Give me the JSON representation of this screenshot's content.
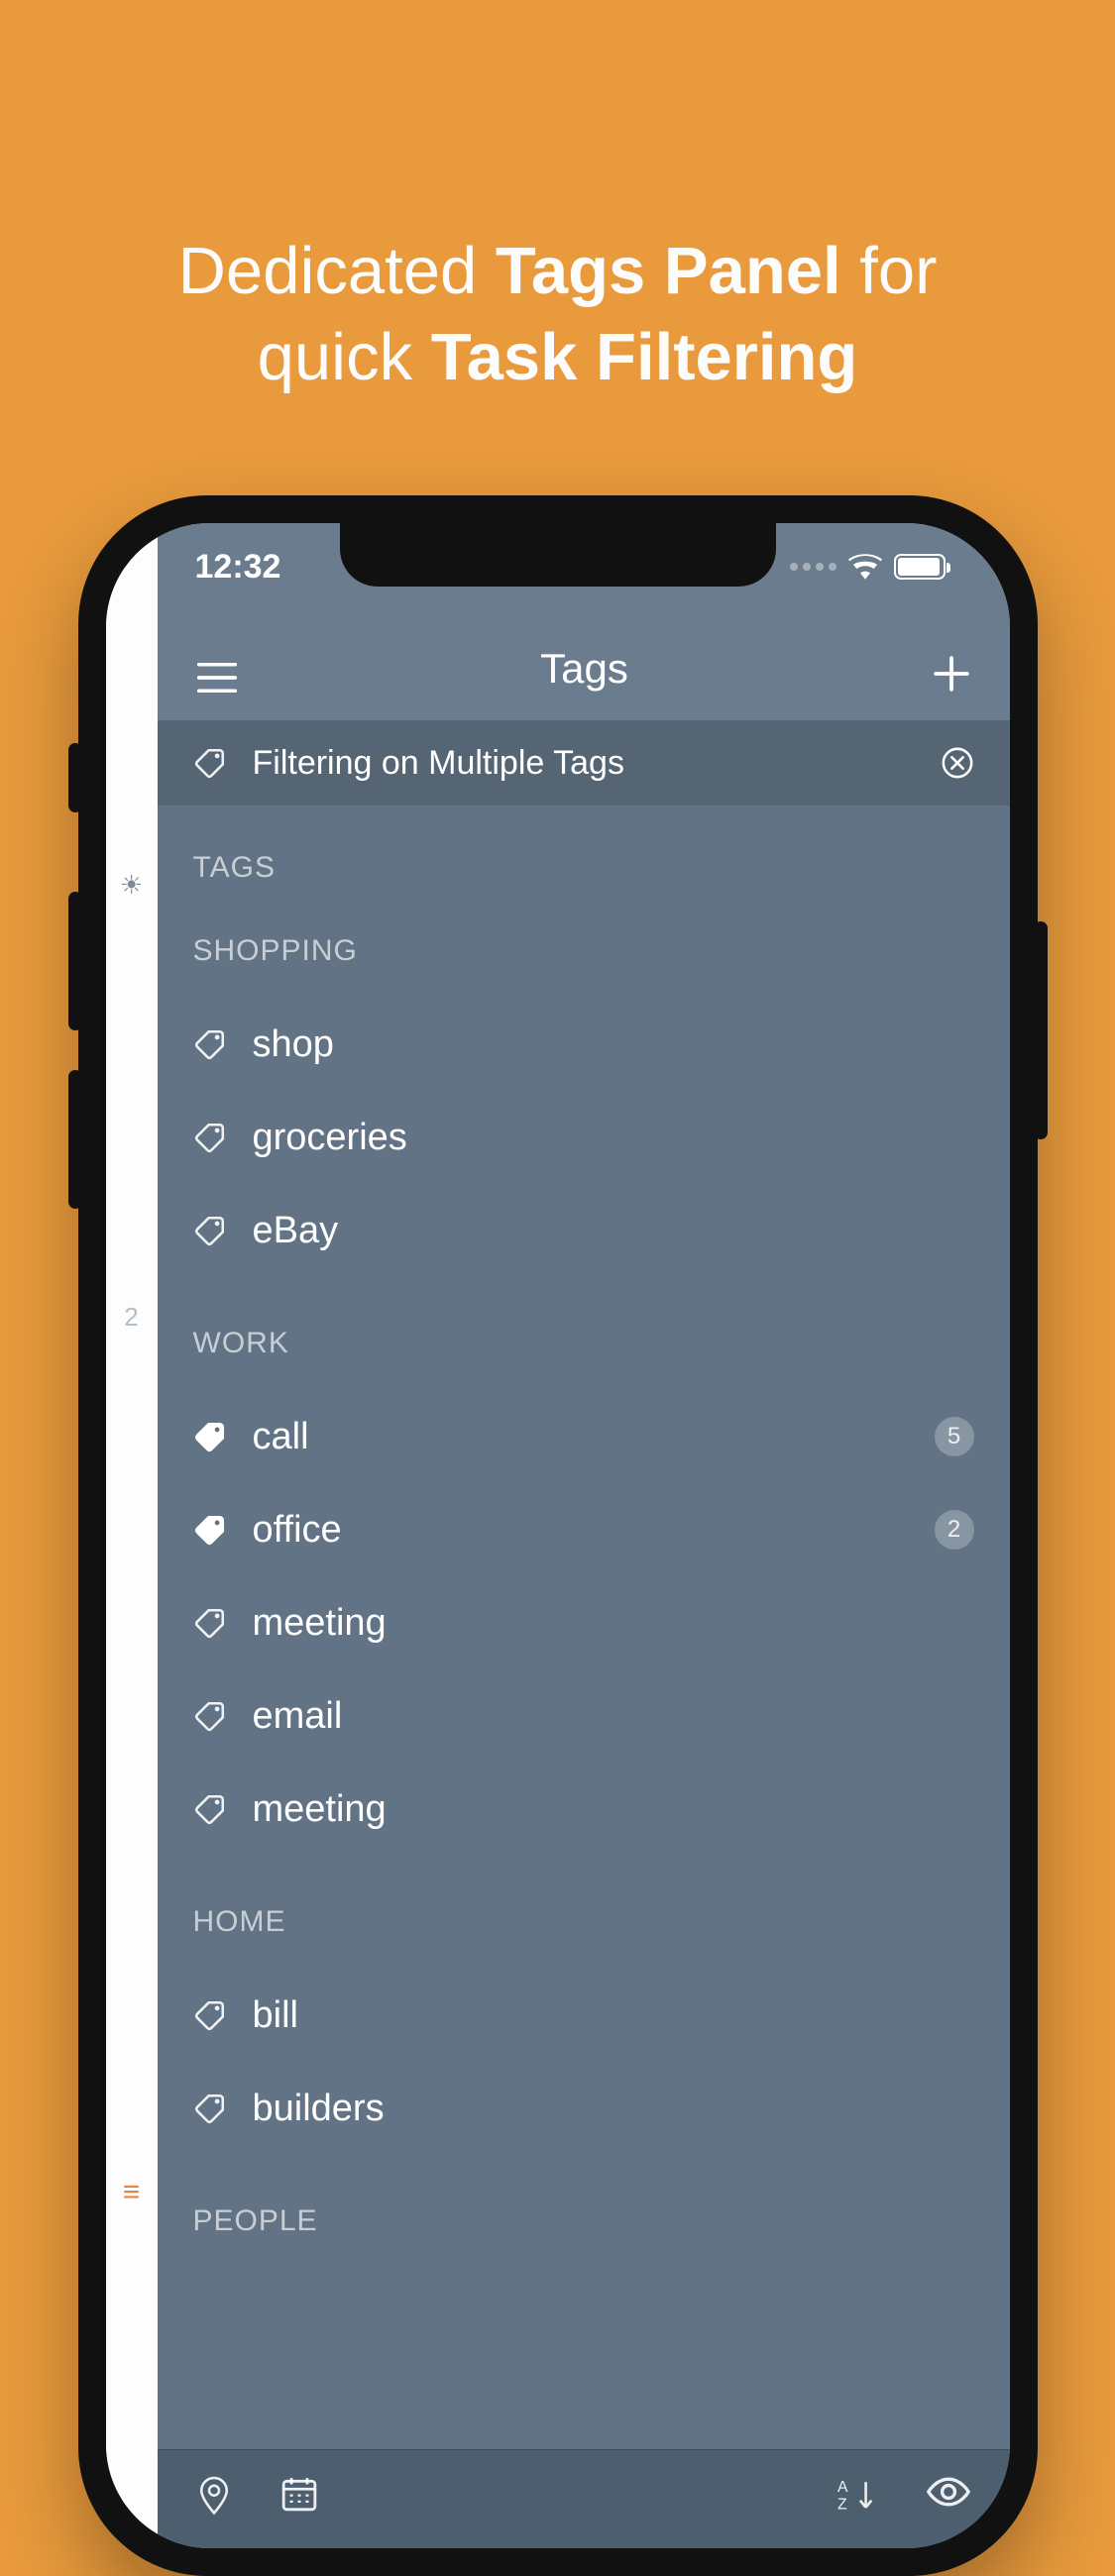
{
  "headline": {
    "text1a": "Dedicated ",
    "text1b": "Tags Panel",
    "text1c": " for",
    "text2a": "quick ",
    "text2b": "Task Filtering"
  },
  "status": {
    "time": "12:32"
  },
  "nav": {
    "title": "Tags"
  },
  "filter": {
    "label": "Filtering on Multiple Tags"
  },
  "master_label": "TAGS",
  "sections": [
    {
      "header": "SHOPPING",
      "tags": [
        {
          "label": "shop",
          "filled": false
        },
        {
          "label": "groceries",
          "filled": false
        },
        {
          "label": "eBay",
          "filled": false
        }
      ]
    },
    {
      "header": "WORK",
      "tags": [
        {
          "label": "call",
          "filled": true,
          "badge": "5"
        },
        {
          "label": "office",
          "filled": true,
          "badge": "2"
        },
        {
          "label": "meeting",
          "filled": false
        },
        {
          "label": "email",
          "filled": false
        },
        {
          "label": "meeting",
          "filled": false
        }
      ]
    },
    {
      "header": "HOME",
      "tags": [
        {
          "label": "bill",
          "filled": false
        },
        {
          "label": "builders",
          "filled": false
        }
      ]
    },
    {
      "header": "PEOPLE",
      "tags": []
    }
  ],
  "back_strip": {
    "count_2": "2"
  }
}
